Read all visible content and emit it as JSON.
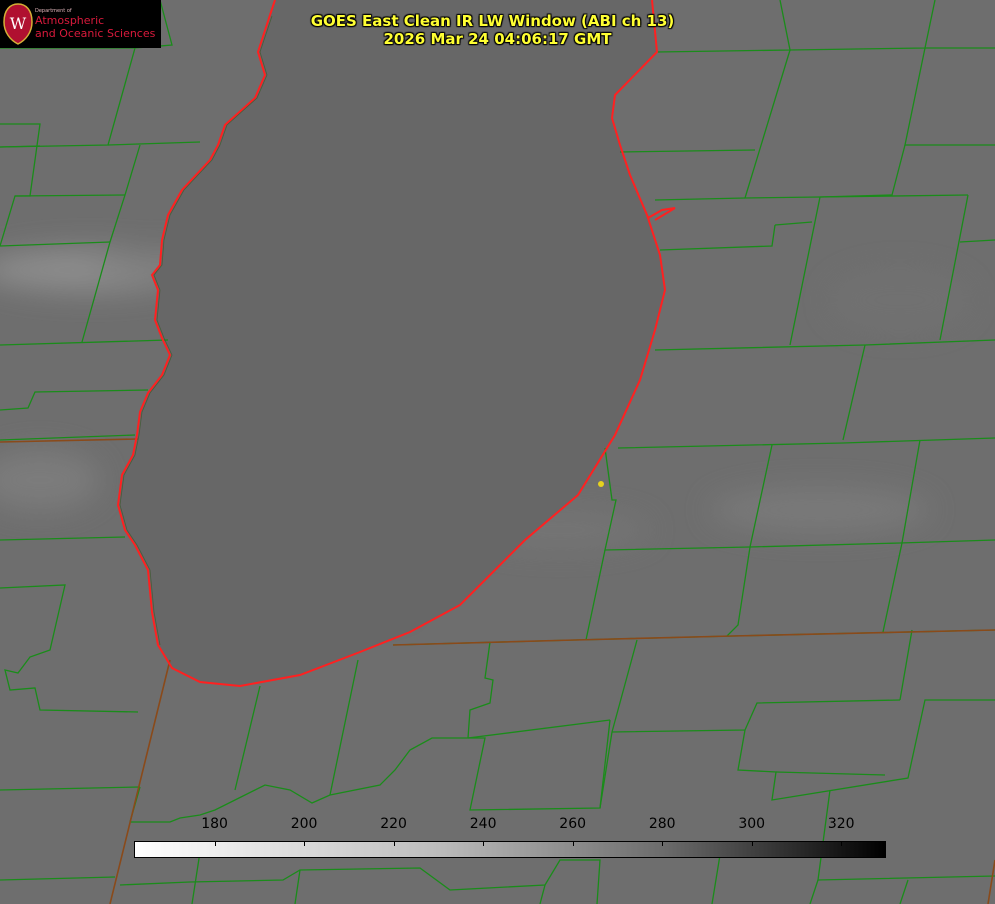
{
  "title": {
    "line1": "GOES East Clean IR LW Window (ABI ch 13)",
    "line2": "2026 Mar 24 04:06:17 GMT"
  },
  "logo": {
    "department": "Department of",
    "line1": "Atmospheric",
    "line2": "and Oceanic Sciences",
    "seal_letter": "W"
  },
  "colorbar": {
    "labels": [
      "180",
      "200",
      "220",
      "240",
      "260",
      "280",
      "300",
      "320"
    ],
    "min": 162,
    "max": 330
  },
  "colors": {
    "title": "#ffff33",
    "coastline": "#ff2020",
    "county_border": "#1a8c1a",
    "state_border": "#8a4a1a",
    "lake": "#666666",
    "land": "#6e6e6e",
    "marker": "#e6d21e"
  }
}
